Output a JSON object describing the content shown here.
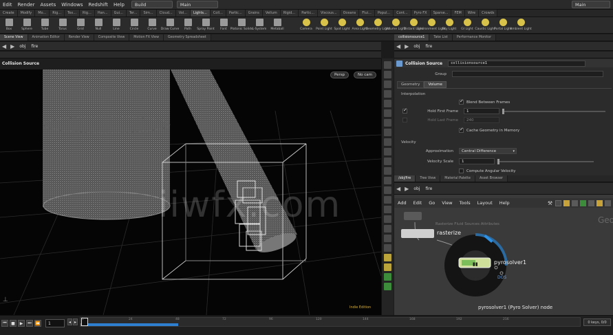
{
  "menubar": {
    "items": [
      "Edit",
      "Render",
      "Assets",
      "Windows",
      "Redshift",
      "Help"
    ],
    "desktop": "Build",
    "context": "Main",
    "right_dropdown": "Main"
  },
  "shelf_tabs": [
    "Create",
    "Modify",
    "Mo...",
    "Rig...",
    "Tex...",
    "Rig...",
    "Han...",
    "Gui...",
    "Ter...",
    "Sim...",
    "Cloud...",
    "Vol...",
    "Lights...",
    "Coll...",
    "Partic...",
    "Grains",
    "Vellum",
    "Rigid...",
    "Partic...",
    "Viscous...",
    "Oceans",
    "Flui...",
    "Popul...",
    "Cont...",
    "Pyro FX",
    "Sparse...",
    "FEM",
    "Wire",
    "Crowds"
  ],
  "shelf_tools_left": [
    {
      "label": "Box",
      "icon": "box-icon"
    },
    {
      "label": "Sphere",
      "icon": "sphere-icon"
    },
    {
      "label": "Tube",
      "icon": "tube-icon"
    },
    {
      "label": "Torus",
      "icon": "torus-icon"
    },
    {
      "label": "Grid",
      "icon": "grid-icon"
    },
    {
      "label": "Null",
      "icon": "null-icon"
    },
    {
      "label": "Line",
      "icon": "line-icon"
    },
    {
      "label": "Circle",
      "icon": "circle-icon"
    },
    {
      "label": "Curve",
      "icon": "curve-icon"
    },
    {
      "label": "Draw Curve",
      "icon": "draw-curve-icon"
    },
    {
      "label": "Path",
      "icon": "path-icon"
    },
    {
      "label": "Spray Paint",
      "icon": "spray-paint-icon"
    },
    {
      "label": "Font",
      "icon": "font-icon"
    },
    {
      "label": "Platonic Solids",
      "icon": "platonic-icon"
    },
    {
      "label": "L-System",
      "icon": "lsystem-icon"
    },
    {
      "label": "Metaball",
      "icon": "metaball-icon"
    }
  ],
  "shelf_tools_right": [
    {
      "label": "Camera",
      "icon": "camera-icon"
    },
    {
      "label": "Point Light",
      "icon": "point-light-icon"
    },
    {
      "label": "Spot Light",
      "icon": "spot-light-icon"
    },
    {
      "label": "Area Light",
      "icon": "area-light-icon"
    },
    {
      "label": "Geometry Light",
      "icon": "geometry-light-icon"
    },
    {
      "label": "Volume Light",
      "icon": "volume-light-icon"
    },
    {
      "label": "Distant Light",
      "icon": "distant-light-icon"
    },
    {
      "label": "Environment Light",
      "icon": "environment-light-icon"
    },
    {
      "label": "Sky Light",
      "icon": "sky-light-icon"
    },
    {
      "label": "GI Light",
      "icon": "gi-light-icon"
    },
    {
      "label": "Caustic Light",
      "icon": "caustic-light-icon"
    },
    {
      "label": "Portal Light",
      "icon": "portal-light-icon"
    },
    {
      "label": "Ambient Light",
      "icon": "ambient-light-icon"
    }
  ],
  "viewport_tabs": [
    "Scene View",
    "Animation Editor",
    "Render View",
    "Composite View",
    "Motion FX View",
    "Geometry Spreadsheet"
  ],
  "viewport_path": [
    "obj",
    "fire"
  ],
  "viewport": {
    "node_label": "Collision Source",
    "persp": "Persp",
    "cam": "No cam",
    "edition": "Indie Edition"
  },
  "param_tabs": [
    "collisionsource1",
    "Take List",
    "Performance Monitor"
  ],
  "param_path": [
    "obj",
    "fire"
  ],
  "params": {
    "node_type": "Collision Source",
    "node_name": "collisionsource1",
    "group_label": "Group",
    "subtabs": [
      "Geometry",
      "Volume"
    ],
    "interpolation_heading": "Interpolation",
    "blend_label": "Blend Between Frames",
    "hold_first_label": "Hold First Frame",
    "hold_first_value": "1",
    "hold_last_label": "Hold Last Frame",
    "hold_last_value": "240",
    "cache_label": "Cache Geometry in Memory",
    "velocity_heading": "Velocity",
    "approx_label": "Approximation",
    "approx_value": "Central Difference",
    "vscale_label": "Velocity Scale",
    "vscale_value": "1",
    "compute_label": "Compute Angular Velocity"
  },
  "net_tabs": [
    "/obj/fire",
    "Tree View",
    "Material Palette",
    "Asset Browser"
  ],
  "net_path": [
    "obj",
    "fire"
  ],
  "net_menu": [
    "Add",
    "Edit",
    "Go",
    "View",
    "Tools",
    "Layout",
    "Help"
  ],
  "network": {
    "node1": "rasterize",
    "node1_hint": "Rasterize Fluid Sources Attributes",
    "node2": "pyrosolver1",
    "node2_badge": "DOS",
    "context_label": "Geo",
    "status": "pyrosolver1 (Pyro Solver) node"
  },
  "timeline": {
    "frame": "1",
    "ticks": [
      "1",
      "24",
      "48",
      "72",
      "96",
      "120",
      "144",
      "168",
      "192",
      "216"
    ],
    "keys_label": "0 keys, 0/0"
  },
  "watermark": "iiwfx.com"
}
